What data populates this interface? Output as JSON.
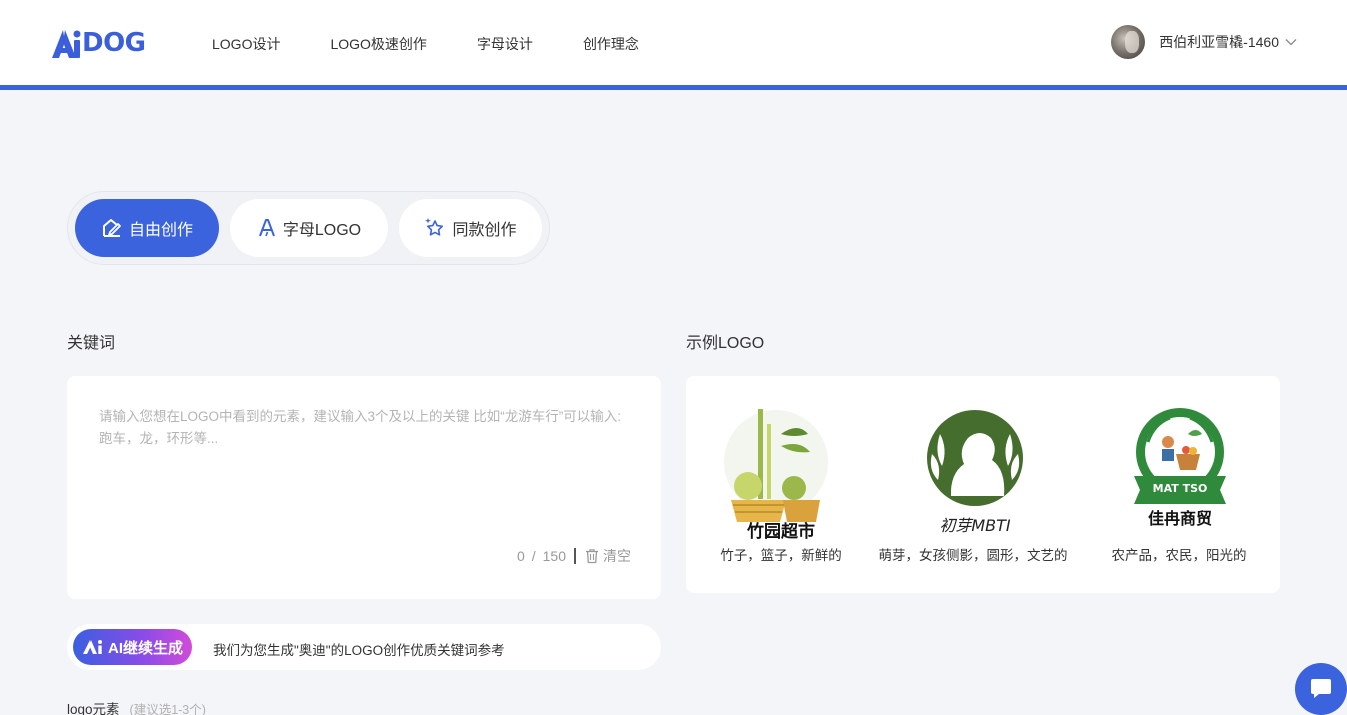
{
  "header": {
    "logo_text": "DOG",
    "nav": [
      "LOGO设计",
      "LOGO极速创作",
      "字母设计",
      "创作理念"
    ],
    "username": "西伯利亚雪橇-1460"
  },
  "modes": [
    {
      "label": "自由创作",
      "icon": "pen-edit-icon",
      "active": true
    },
    {
      "label": "字母LOGO",
      "icon": "letter-a-icon",
      "active": false
    },
    {
      "label": "同款创作",
      "icon": "star-sparkle-icon",
      "active": false
    }
  ],
  "keywords": {
    "title": "关键词",
    "placeholder": "请输入您想在LOGO中看到的元素，建议输入3个及以上的关键 比如“龙游车行”可以输入: 跑车，龙，环形等...",
    "count": "0",
    "slash": "/",
    "max": "150",
    "clear_label": "清空"
  },
  "ai": {
    "button_label": "AI继续生成",
    "hint": "我们为您生成\"奥迪\"的LOGO创作优质关键词参考"
  },
  "elements": {
    "title": "logo元素",
    "subtitle": "(建议选1-3个)"
  },
  "examples": {
    "title": "示例LOGO",
    "items": [
      {
        "logo_text": "竹园超市",
        "caption": "竹子，篮子，新鲜的"
      },
      {
        "logo_text": "初芽MBTI",
        "caption": "萌芽，女孩侧影，圆形，文艺的"
      },
      {
        "logo_text": "佳冉商贸",
        "badge": "MAT TSO",
        "caption": "农产品，农民，阳光的"
      }
    ]
  },
  "colors": {
    "accent": "#3a63dd",
    "background": "#f4f5f9",
    "example_green": "#3f6b2a",
    "badge_green": "#2f8a3c"
  }
}
